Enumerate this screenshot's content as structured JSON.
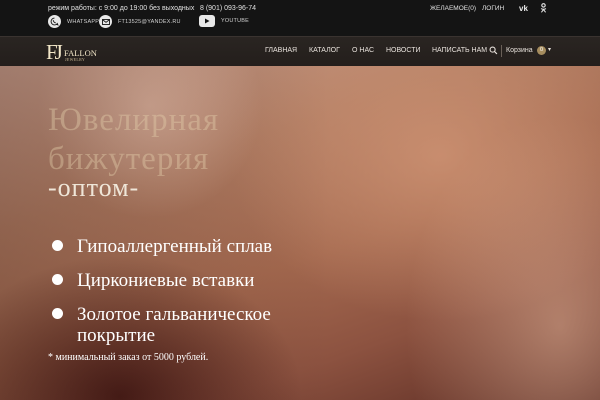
{
  "topbar": {
    "hours": "режим работы: с 9:00 до 19:00 без выходных",
    "phone": "8 (901) 093-96-74",
    "wishlist": "ЖЕЛАЕМОЕ(0)",
    "login": "ЛОГИН",
    "vk": "vk",
    "ok": "ok",
    "whatsapp": "WHATSAPP",
    "email": "FT13525@YANDEX.RU",
    "youtube": "YOUTUBE"
  },
  "logo": {
    "mono": "FJ",
    "brand": "FALLON",
    "sub": "JEWELRY"
  },
  "nav": {
    "items": [
      "ГЛАВНАЯ",
      "КАТАЛОГ",
      "О НАС",
      "НОВОСТИ",
      "НАПИСАТЬ НАМ"
    ],
    "cart_label": "Корзина",
    "cart_count": "0"
  },
  "hero": {
    "line1": "Ювелирная",
    "line2": "бижутерия",
    "line3": "-оптом-",
    "bullets": [
      "Гипоаллергенный сплав",
      "Циркониевые вставки",
      "Золотое гальваническое покрытие"
    ],
    "note": "* минимальный заказ от 5000 рублей."
  },
  "icons": {
    "whatsapp": "whatsapp-icon",
    "email": "envelope-icon",
    "youtube": "youtube-icon",
    "search": "search-icon",
    "cart_caret": "caret-down-icon"
  },
  "colors": {
    "accent": "#a58c5e",
    "topbar": "#141414",
    "navbar": "#2a2522"
  }
}
